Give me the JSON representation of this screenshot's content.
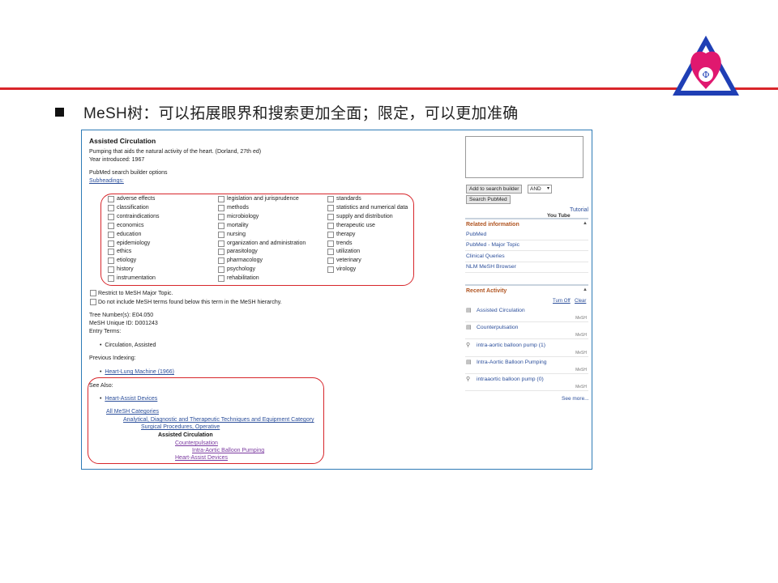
{
  "slide": {
    "title": "MeSH树：可以拓展眼界和搜索更加全面；限定，可以更加准确"
  },
  "mesh": {
    "heading": "Assisted Circulation",
    "definition": "Pumping that aids the natural activity of the heart. (Dorland, 27th ed)",
    "year_introduced": "Year introduced: 1967",
    "builder_options": "PubMed search builder options",
    "subheadings_link": "Subheadings:",
    "subheadings": {
      "col1": [
        "adverse effects",
        "classification",
        "contraindications",
        "economics",
        "education",
        "epidemiology",
        "ethics",
        "etiology",
        "history",
        "instrumentation"
      ],
      "col2": [
        "legislation and jurisprudence",
        "methods",
        "microbiology",
        "mortality",
        "nursing",
        "organization and administration",
        "parasitology",
        "pharmacology",
        "psychology",
        "rehabilitation"
      ],
      "col3": [
        "standards",
        "statistics and numerical data",
        "supply and distribution",
        "therapeutic use",
        "therapy",
        "trends",
        "utilization",
        "veterinary",
        "virology"
      ]
    },
    "restrict_major": "Restrict to MeSH Major Topic.",
    "no_explode": "Do not include MeSH terms found below this term in the MeSH hierarchy.",
    "tree_number": "Tree Number(s): E04.050",
    "unique_id": "MeSH Unique ID: D001243",
    "entry_terms_label": "Entry Terms:",
    "entry_terms": [
      "Circulation, Assisted"
    ],
    "previous_indexing_label": "Previous Indexing:",
    "previous_indexing": [
      "Heart-Lung Machine (1966)"
    ],
    "see_also_label": "See Also:",
    "see_also": [
      "Heart-Assist Devices"
    ],
    "tree": {
      "root": "All MeSH Categories",
      "level1": "Analytical, Diagnostic and Therapeutic Techniques and Equipment Category",
      "level2": "Surgical Procedures, Operative",
      "current": "Assisted Circulation",
      "child1": "Counterpulsation",
      "grandchild1": "Intra-Aortic Balloon Pumping",
      "child2": "Heart-Assist Devices"
    }
  },
  "sidebar": {
    "add_button": "Add to search builder",
    "operator": "AND",
    "search_button": "Search PubMed",
    "tutorial": "Tutorial",
    "youtube_logo_text": "You Tube",
    "related_title": "Related information",
    "related": [
      "PubMed",
      "PubMed - Major Topic",
      "Clinical Queries",
      "NLM MeSH Browser"
    ],
    "recent_title": "Recent Activity",
    "turn_off": "Turn Off",
    "clear": "Clear",
    "activity": [
      {
        "icon": "document-icon",
        "title": "Assisted Circulation",
        "type": "MeSH"
      },
      {
        "icon": "document-icon",
        "title": "Counterpulsation",
        "type": "MeSH"
      },
      {
        "icon": "search-icon",
        "title": "intra-aortic balloon pump (1)",
        "type": "MeSH"
      },
      {
        "icon": "document-icon",
        "title": "Intra-Aortic Balloon Pumping",
        "type": "MeSH"
      },
      {
        "icon": "search-icon",
        "title": "intraaortic balloon pump (0)",
        "type": "MeSH"
      }
    ],
    "see_more": "See more..."
  },
  "colors": {
    "accent_red": "#d9252a",
    "link_blue": "#2c4f9b",
    "panel_orange": "#b05420",
    "frame_blue": "#2e7bb6"
  }
}
